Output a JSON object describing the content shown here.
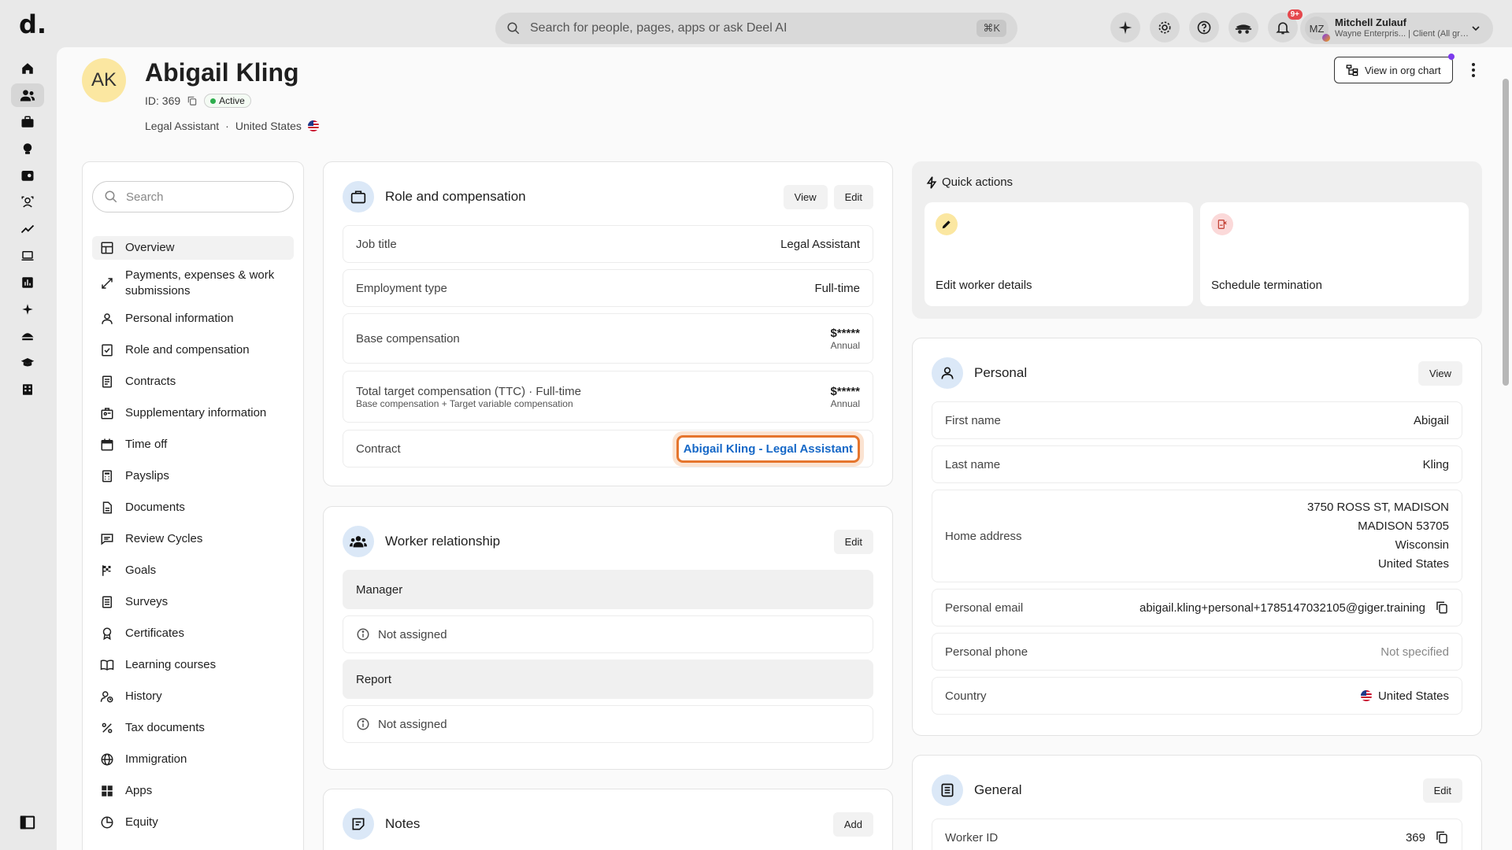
{
  "topbar": {
    "logo": "d.",
    "search_placeholder": "Search for people, pages, apps or ask Deel AI",
    "search_shortcut": "⌘K",
    "notifications_badge": "9+",
    "user_initials": "MZ",
    "user_name": "Mitchell Zulauf",
    "user_org": "Wayne Enterpris... | Client (All gro..."
  },
  "profile": {
    "initials": "AK",
    "name": "Abigail Kling",
    "id_label": "ID: 369",
    "status": "Active",
    "job": "Legal Assistant",
    "separator": "·",
    "country": "United States",
    "org_chart_button": "View in org chart"
  },
  "sidenav": {
    "search_placeholder": "Search",
    "items": [
      {
        "label": "Overview",
        "icon": "overview-icon"
      },
      {
        "label": "Payments, expenses & work submissions",
        "icon": "arrows-icon"
      },
      {
        "label": "Personal information",
        "icon": "person-icon"
      },
      {
        "label": "Role and compensation",
        "icon": "checklist-icon"
      },
      {
        "label": "Contracts",
        "icon": "contract-icon"
      },
      {
        "label": "Supplementary information",
        "icon": "supplementary-icon"
      },
      {
        "label": "Time off",
        "icon": "calendar-icon"
      },
      {
        "label": "Payslips",
        "icon": "calculator-icon"
      },
      {
        "label": "Documents",
        "icon": "document-icon"
      },
      {
        "label": "Review Cycles",
        "icon": "review-icon"
      },
      {
        "label": "Goals",
        "icon": "flag-icon"
      },
      {
        "label": "Surveys",
        "icon": "survey-icon"
      },
      {
        "label": "Certificates",
        "icon": "certificate-icon"
      },
      {
        "label": "Learning courses",
        "icon": "book-icon"
      },
      {
        "label": "History",
        "icon": "history-icon"
      },
      {
        "label": "Tax documents",
        "icon": "percent-icon"
      },
      {
        "label": "Immigration",
        "icon": "globe-icon"
      },
      {
        "label": "Apps",
        "icon": "apps-icon"
      },
      {
        "label": "Equity",
        "icon": "pie-icon"
      }
    ]
  },
  "role_card": {
    "title": "Role and compensation",
    "view": "View",
    "edit": "Edit",
    "job_title_label": "Job title",
    "job_title_value": "Legal Assistant",
    "employment_type_label": "Employment type",
    "employment_type_value": "Full-time",
    "base_label": "Base compensation",
    "base_value": "$*****",
    "base_period": "Annual",
    "ttc_label": "Total target compensation (TTC) · Full-time",
    "ttc_sub": "Base compensation + Target variable compensation",
    "ttc_value": "$*****",
    "ttc_period": "Annual",
    "contract_label": "Contract",
    "contract_value": "Abigail Kling - Legal Assistant"
  },
  "worker_card": {
    "title": "Worker relationship",
    "edit": "Edit",
    "manager_label": "Manager",
    "manager_value": "Not assigned",
    "report_label": "Report",
    "report_value": "Not assigned"
  },
  "notes_card": {
    "title": "Notes",
    "add": "Add"
  },
  "quick_actions": {
    "title": "Quick actions",
    "edit_worker": "Edit worker details",
    "schedule_termination": "Schedule termination"
  },
  "personal_card": {
    "title": "Personal",
    "view": "View",
    "first_name_label": "First name",
    "first_name_value": "Abigail",
    "last_name_label": "Last name",
    "last_name_value": "Kling",
    "address_label": "Home address",
    "address_line1": "3750 ROSS ST, MADISON",
    "address_line2": "MADISON 53705",
    "address_line3": "Wisconsin",
    "address_line4": "United States",
    "email_label": "Personal email",
    "email_value": "abigail.kling+personal+1785147032105@giger.training",
    "phone_label": "Personal phone",
    "phone_value": "Not specified",
    "country_label": "Country",
    "country_value": "United States"
  },
  "general_card": {
    "title": "General",
    "edit": "Edit",
    "worker_id_label": "Worker ID",
    "worker_id_value": "369"
  },
  "colors": {
    "accent_link": "#1668c7",
    "focus_ring": "#e5752d",
    "active_dot": "#2eae4e",
    "notification": "#e5484d"
  }
}
